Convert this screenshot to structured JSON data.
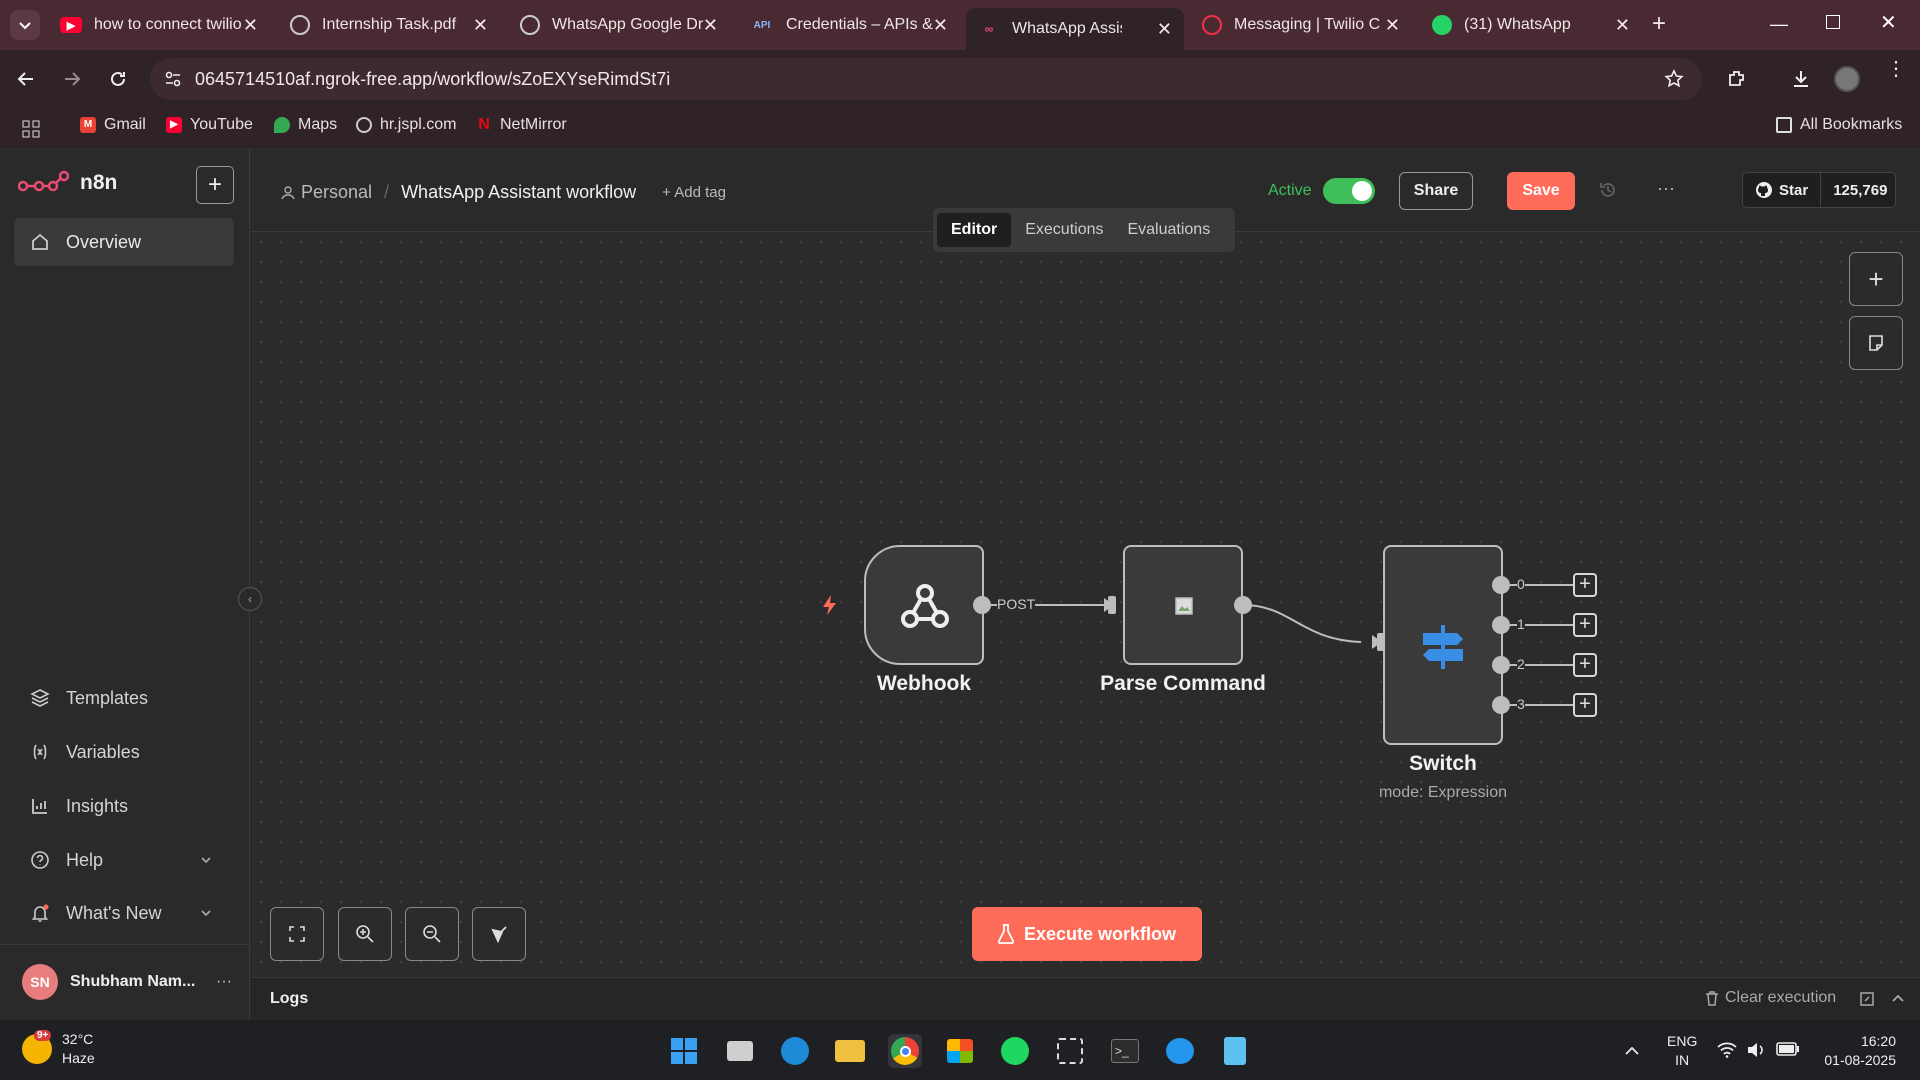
{
  "browser": {
    "tabs": [
      {
        "title": "how to connect twilio",
        "icon": "youtube-icon",
        "color": "#ff0033"
      },
      {
        "title": "Internship Task.pdf",
        "icon": "globe-icon",
        "color": "#cccccc"
      },
      {
        "title": "WhatsApp Google Dr",
        "icon": "openai-icon",
        "color": "#cccccc"
      },
      {
        "title": "Credentials – APIs &",
        "icon": "api-icon",
        "color": "#8ab4f8"
      },
      {
        "title": "WhatsApp Assist",
        "icon": "n8n-icon",
        "color": "#ea4b71"
      },
      {
        "title": "Messaging | Twilio C",
        "icon": "twilio-icon",
        "color": "#f22f46"
      },
      {
        "title": "(31) WhatsApp",
        "icon": "whatsapp-icon",
        "color": "#25d366"
      }
    ],
    "url": "0645714510af.ngrok-free.app/workflow/sZoEXYseRimdSt7i",
    "bookmarks": [
      "Gmail",
      "YouTube",
      "Maps",
      "hr.jspl.com",
      "NetMirror"
    ],
    "all_bookmarks": "All Bookmarks"
  },
  "sidebar": {
    "brand": "n8n",
    "items": [
      {
        "label": "Overview",
        "icon": "home-icon"
      },
      {
        "label": "Templates",
        "icon": "templates-icon"
      },
      {
        "label": "Variables",
        "icon": "variables-icon"
      },
      {
        "label": "Insights",
        "icon": "insights-icon"
      },
      {
        "label": "Help",
        "icon": "help-icon"
      },
      {
        "label": "What's New",
        "icon": "bell-icon"
      }
    ],
    "user": {
      "initials": "SN",
      "name": "Shubham Nam..."
    }
  },
  "header": {
    "project": "Personal",
    "workflow_name": "WhatsApp Assistant workflow",
    "add_tag": "+ Add tag",
    "active_label": "Active",
    "active": true,
    "share": "Share",
    "save": "Save",
    "github_star": "Star",
    "github_count": "125,769",
    "tabs": [
      "Editor",
      "Executions",
      "Evaluations"
    ],
    "selected_tab": "Editor"
  },
  "workflow": {
    "nodes": [
      {
        "name": "Webhook",
        "icon": "webhook-icon"
      },
      {
        "name": "Parse Command",
        "icon": "broken-image-icon"
      },
      {
        "name": "Switch",
        "icon": "switch-signpost-icon",
        "subtitle": "mode: Expression"
      }
    ],
    "edge_label": "POST",
    "switch_outputs": [
      "0",
      "1",
      "2",
      "3"
    ],
    "execute": "Execute workflow"
  },
  "logs": {
    "title": "Logs",
    "clear": "Clear execution"
  },
  "taskbar": {
    "weather_temp": "32°C",
    "weather_desc": "Haze",
    "weather_badge": "9+",
    "lang_top": "ENG",
    "lang_bottom": "IN",
    "time": "16:20",
    "date": "01-08-2025"
  },
  "colors": {
    "accent": "#ff6d5a",
    "active_green": "#3fbf5a",
    "switch_blue": "#3a8ee6"
  }
}
